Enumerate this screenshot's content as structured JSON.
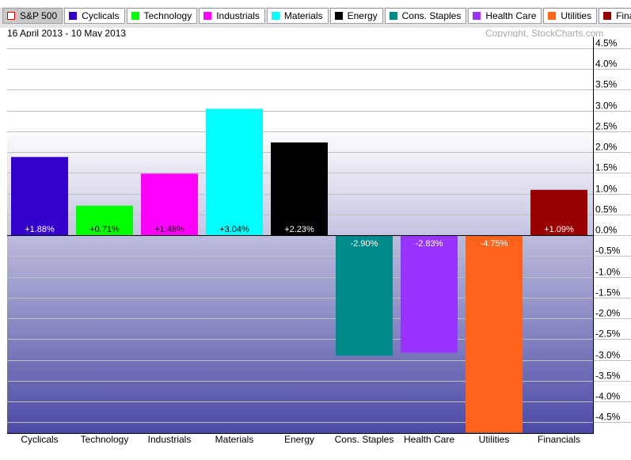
{
  "legend": [
    {
      "label": "S&P 500",
      "color": "#ffffff",
      "border": "#e00000",
      "selected": true
    },
    {
      "label": "Cyclicals",
      "color": "#3300cc"
    },
    {
      "label": "Technology",
      "color": "#00ff00"
    },
    {
      "label": "Industrials",
      "color": "#ff00ff"
    },
    {
      "label": "Materials",
      "color": "#00ffff"
    },
    {
      "label": "Energy",
      "color": "#000000"
    },
    {
      "label": "Cons. Staples",
      "color": "#008b8b"
    },
    {
      "label": "Health Care",
      "color": "#9933ff"
    },
    {
      "label": "Utilities",
      "color": "#ff6319"
    },
    {
      "label": "Financials",
      "color": "#990000"
    }
  ],
  "header": {
    "date_range": "16 April 2013 - 10 May 2013",
    "copyright": "Copyright, StockCharts.com"
  },
  "chart_data": {
    "type": "bar",
    "title": "",
    "subtitle": "16 April 2013 - 10 May 2013",
    "xlabel": "",
    "ylabel": "",
    "categories": [
      "Cyclicals",
      "Technology",
      "Industrials",
      "Materials",
      "Energy",
      "Cons. Staples",
      "Health Care",
      "Utilities",
      "Financials"
    ],
    "values": [
      1.88,
      0.71,
      1.48,
      3.04,
      2.23,
      -2.9,
      -2.83,
      -4.75,
      1.09
    ],
    "data_labels": [
      "+1.88%",
      "+0.71%",
      "+1.48%",
      "+3.04%",
      "+2.23%",
      "-2.90%",
      "-2.83%",
      "-4.75%",
      "+1.09%"
    ],
    "colors": [
      "#3300cc",
      "#00ff00",
      "#ff00ff",
      "#00ffff",
      "#000000",
      "#008b8b",
      "#9933ff",
      "#ff6319",
      "#990000"
    ],
    "label_colors": [
      "#ffffff",
      "#000000",
      "#000000",
      "#000000",
      "#ffffff",
      "#ffffff",
      "#ffffff",
      "#ffffff",
      "#ffffff"
    ],
    "yticks": [
      4.5,
      4.0,
      3.5,
      3.0,
      2.5,
      2.0,
      1.5,
      1.0,
      0.5,
      0.0,
      -0.5,
      -1.0,
      -1.5,
      -2.0,
      -2.5,
      -3.0,
      -3.5,
      -4.0,
      -4.5
    ],
    "ytick_labels": [
      "4.5%",
      "4.0%",
      "3.5%",
      "3.0%",
      "2.5%",
      "2.0%",
      "1.5%",
      "1.0%",
      "0.5%",
      "0.0%",
      "-0.5%",
      "-1.0%",
      "-1.5%",
      "-2.0%",
      "-2.5%",
      "-3.0%",
      "-3.5%",
      "-4.0%",
      "-4.5%"
    ],
    "ylim": [
      -4.75,
      4.9
    ],
    "grid": true,
    "y_axis_side": "right",
    "legend_placement": "top"
  }
}
